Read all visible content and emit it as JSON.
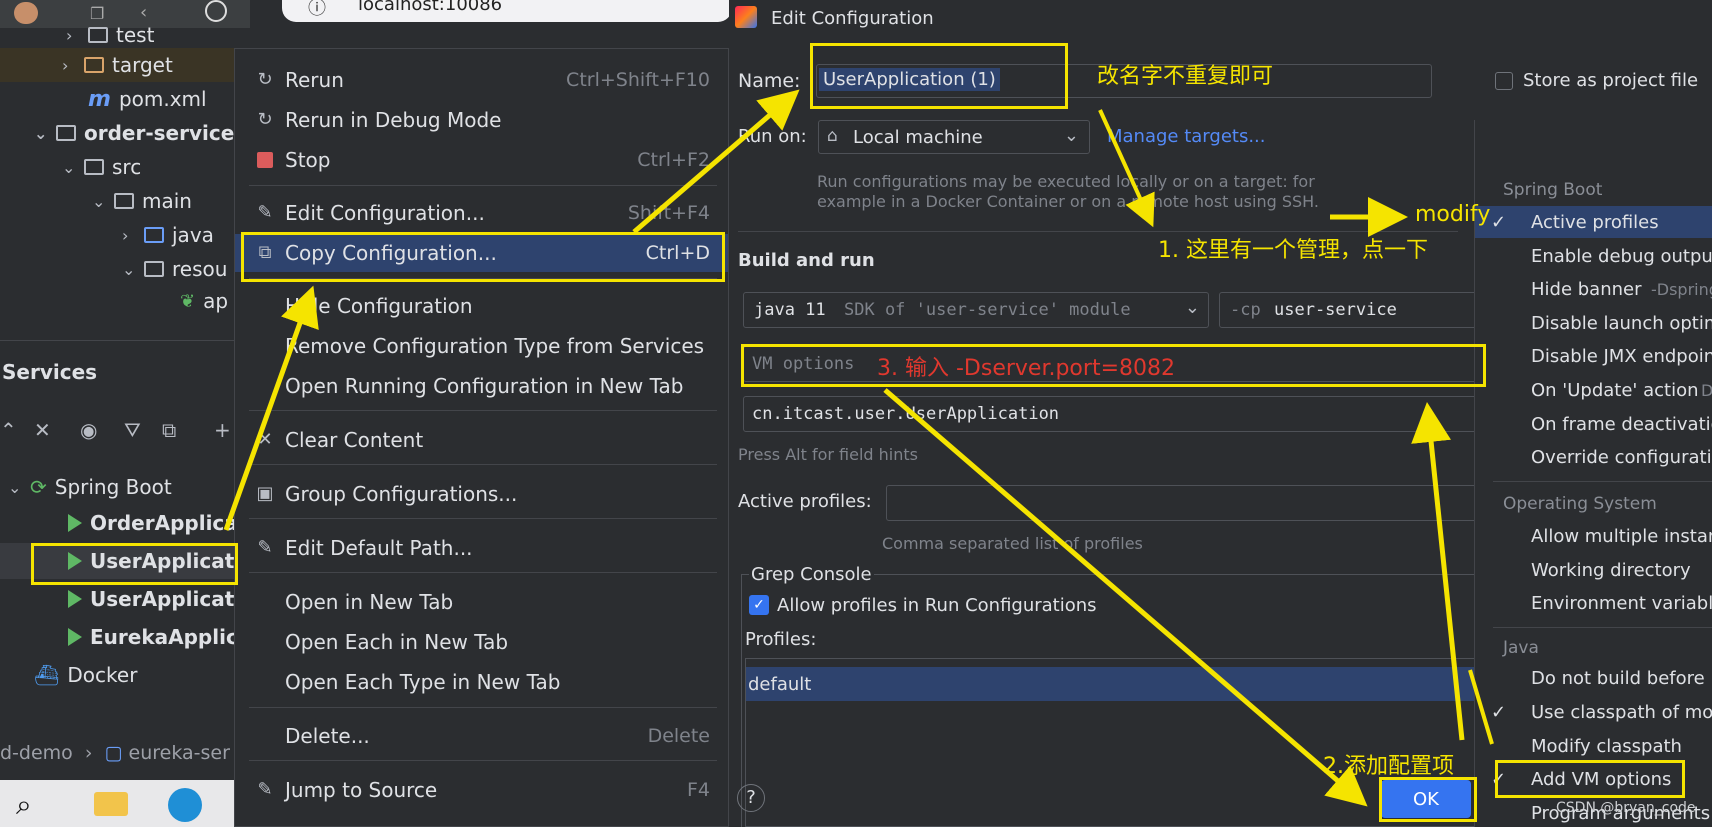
{
  "browser_bar": {
    "url": "localhost:10086"
  },
  "project_tree": {
    "items": [
      {
        "label": "test"
      },
      {
        "label": "target"
      },
      {
        "label": "pom.xml"
      },
      {
        "label": "order-service"
      },
      {
        "label": "src"
      },
      {
        "label": "main"
      },
      {
        "label": "java"
      },
      {
        "label": "resou"
      },
      {
        "label": "ap"
      }
    ]
  },
  "services": {
    "title": "Services",
    "tree": [
      {
        "label": "Spring Boot"
      },
      {
        "label": "OrderApplica"
      },
      {
        "label": "UserApplicati"
      },
      {
        "label": "UserApplicati"
      },
      {
        "label": "EurekaApplica"
      },
      {
        "label": "Docker"
      }
    ]
  },
  "status_bar": {
    "crumb1": "d-demo",
    "crumb2": "eureka-ser"
  },
  "context_menu": {
    "items": [
      {
        "label": "Rerun",
        "shortcut": "Ctrl+Shift+F10",
        "icon": "rerun-icon"
      },
      {
        "label": "Rerun in Debug Mode",
        "shortcut": "",
        "icon": "debug-rerun-icon"
      },
      {
        "label": "Stop",
        "shortcut": "Ctrl+F2",
        "icon": "stop-icon"
      },
      {
        "label": "Edit Configuration...",
        "shortcut": "Shift+F4",
        "icon": "edit-icon"
      },
      {
        "label": "Copy Configuration...",
        "shortcut": "Ctrl+D",
        "icon": "copy-icon"
      },
      {
        "label": "Hide Configuration",
        "shortcut": "",
        "icon": ""
      },
      {
        "label": "Remove Configuration Type from Services",
        "shortcut": "",
        "icon": ""
      },
      {
        "label": "Open Running Configuration in New Tab",
        "shortcut": "",
        "icon": ""
      },
      {
        "label": "Clear Content",
        "shortcut": "",
        "icon": "clear-icon"
      },
      {
        "label": "Group Configurations...",
        "shortcut": "",
        "icon": "group-icon"
      },
      {
        "label": "Edit Default Path...",
        "shortcut": "",
        "icon": "edit-icon"
      },
      {
        "label": "Open in New Tab",
        "shortcut": "",
        "icon": ""
      },
      {
        "label": "Open Each in New Tab",
        "shortcut": "",
        "icon": ""
      },
      {
        "label": "Open Each Type in New Tab",
        "shortcut": "",
        "icon": ""
      },
      {
        "label": "Delete...",
        "shortcut": "Delete",
        "icon": ""
      },
      {
        "label": "Jump to Source",
        "shortcut": "F4",
        "icon": "edit-icon"
      }
    ]
  },
  "dialog": {
    "title": "Edit Configuration",
    "name_label": "Name:",
    "name_value": "UserApplication (1)",
    "store_label": "Store as project file",
    "run_on_label": "Run on:",
    "run_on_value": "Local machine",
    "manage_targets": "Manage targets...",
    "run_on_hint1": "Run configurations may be executed locally or on a target: for",
    "run_on_hint2": "example in a Docker Container or on a remote host using SSH.",
    "build_run_title": "Build and run",
    "sdk_java": "java 11",
    "sdk_desc": "SDK of 'user-service' module",
    "cp_flag": "-cp",
    "cp_value": "user-service",
    "vm_placeholder": "VM options",
    "main_class": "cn.itcast.user.UserApplication",
    "alt_hint": "Press Alt for field hints",
    "active_profiles_label": "Active profiles:",
    "active_profiles_hint": "Comma separated list of profiles",
    "grep_console_title": "Grep Console",
    "allow_profiles_label": "Allow profiles in Run Configurations",
    "allow_profiles_checked": true,
    "profiles_label": "Profiles:",
    "profiles_items": [
      "default"
    ],
    "ok_label": "OK",
    "help_label": "?"
  },
  "modify_options": {
    "sections": [
      {
        "title": "Spring Boot",
        "items": [
          {
            "label": "Active profiles",
            "checked": true,
            "selected": true
          },
          {
            "label": "Enable debug output",
            "checked": false
          },
          {
            "label": "Hide banner",
            "checked": false,
            "hint": "-Dspring"
          },
          {
            "label": "Disable launch optim",
            "checked": false
          },
          {
            "label": "Disable JMX endpoin",
            "checked": false
          },
          {
            "label": "On 'Update' action",
            "checked": false,
            "hint": "D"
          },
          {
            "label": "On frame deactivatio",
            "checked": false
          },
          {
            "label": "Override configuratio",
            "checked": false
          }
        ]
      },
      {
        "title": "Operating System",
        "items": [
          {
            "label": "Allow multiple instanc",
            "checked": false
          },
          {
            "label": "Working directory",
            "checked": false
          },
          {
            "label": "Environment variable",
            "checked": false
          }
        ]
      },
      {
        "title": "Java",
        "items": [
          {
            "label": "Do not build before r",
            "checked": false
          },
          {
            "label": "Use classpath of mod",
            "checked": true
          },
          {
            "label": "Modify classpath",
            "checked": false
          },
          {
            "label": "Add VM options",
            "checked": true
          },
          {
            "label": "Program arguments",
            "checked": false
          }
        ]
      }
    ]
  },
  "annotations": {
    "rename_note": "改名字不重复即可",
    "modify_label": "modify",
    "step1": "1. 这里有一个管理，点一下",
    "step2": "2.添加配置项",
    "step3": "3. 输入 -Dserver.port=8082",
    "watermark": "CSDN @bryan_code"
  },
  "colors": {
    "accent": "#3574f0",
    "annotation": "#f5e400",
    "annotation_red": "#e0382e",
    "panel_bg": "#2b2d30",
    "selection": "#2e436e"
  }
}
